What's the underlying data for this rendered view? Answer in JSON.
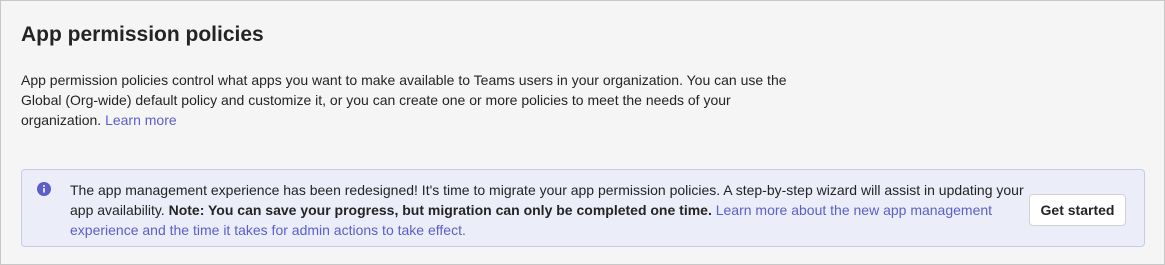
{
  "page": {
    "title": "App permission policies",
    "description": "App permission policies control what apps you want to make available to Teams users in your organization. You can use the Global (Org-wide) default policy and customize it, or you can create one or more policies to meet the needs of your organization.",
    "learn_more_label": "Learn more"
  },
  "banner": {
    "icon": "info-icon",
    "text": "The app management experience has been redesigned! It's time to migrate your app permission policies. A step-by-step wizard will assist in updating your app availability.",
    "bold_note": "Note: You can save your progress, but migration can only be completed one time.",
    "link_label": "Learn more about the new app management experience and the time it takes for admin actions to take effect.",
    "button_label": "Get started"
  },
  "colors": {
    "accent": "#5b5fc7",
    "banner_background": "#ebedf8",
    "banner_border": "#c7cbe8",
    "page_background": "#f5f5f5",
    "text": "#242424"
  }
}
